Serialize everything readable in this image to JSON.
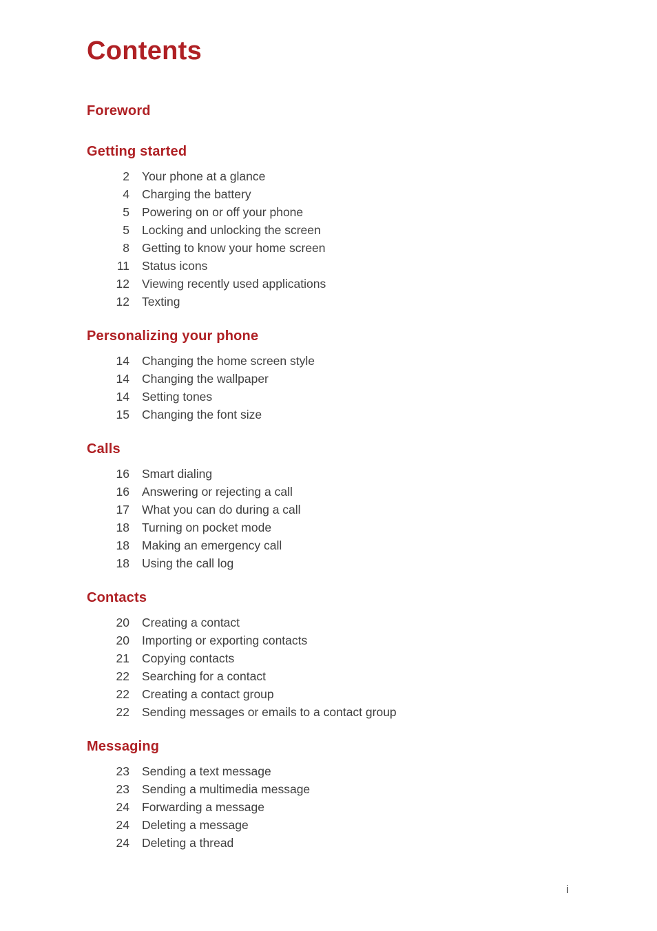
{
  "page": {
    "title": "Contents",
    "folio": "i",
    "accent_color": "#AF2024",
    "text_color": "#404040",
    "background_color": "#FFFFFF"
  },
  "toc": {
    "sections": [
      {
        "heading": "Foreword",
        "entries": []
      },
      {
        "heading": "Getting started",
        "entries": [
          {
            "page": "2",
            "title": "Your phone at a glance"
          },
          {
            "page": "4",
            "title": "Charging the battery"
          },
          {
            "page": "5",
            "title": "Powering on or off your phone"
          },
          {
            "page": "5",
            "title": "Locking and unlocking the screen"
          },
          {
            "page": "8",
            "title": "Getting to know your home screen"
          },
          {
            "page": "11",
            "title": "Status icons"
          },
          {
            "page": "12",
            "title": "Viewing recently used applications"
          },
          {
            "page": "12",
            "title": "Texting"
          }
        ]
      },
      {
        "heading": "Personalizing your phone",
        "entries": [
          {
            "page": "14",
            "title": "Changing the home screen style"
          },
          {
            "page": "14",
            "title": "Changing the wallpaper"
          },
          {
            "page": "14",
            "title": "Setting tones"
          },
          {
            "page": "15",
            "title": "Changing the font size"
          }
        ]
      },
      {
        "heading": "Calls",
        "entries": [
          {
            "page": "16",
            "title": "Smart dialing"
          },
          {
            "page": "16",
            "title": "Answering or rejecting a call"
          },
          {
            "page": "17",
            "title": "What you can do during a call"
          },
          {
            "page": "18",
            "title": "Turning on pocket mode"
          },
          {
            "page": "18",
            "title": "Making an emergency call"
          },
          {
            "page": "18",
            "title": "Using the call log"
          }
        ]
      },
      {
        "heading": "Contacts",
        "entries": [
          {
            "page": "20",
            "title": "Creating a contact"
          },
          {
            "page": "20",
            "title": "Importing or exporting contacts"
          },
          {
            "page": "21",
            "title": "Copying contacts"
          },
          {
            "page": "22",
            "title": "Searching for a contact"
          },
          {
            "page": "22",
            "title": "Creating a contact group"
          },
          {
            "page": "22",
            "title": "Sending messages or emails to a contact group"
          }
        ]
      },
      {
        "heading": "Messaging",
        "entries": [
          {
            "page": "23",
            "title": "Sending a text message"
          },
          {
            "page": "23",
            "title": "Sending a multimedia message"
          },
          {
            "page": "24",
            "title": "Forwarding a message"
          },
          {
            "page": "24",
            "title": "Deleting a message"
          },
          {
            "page": "24",
            "title": "Deleting a thread"
          }
        ]
      }
    ]
  }
}
